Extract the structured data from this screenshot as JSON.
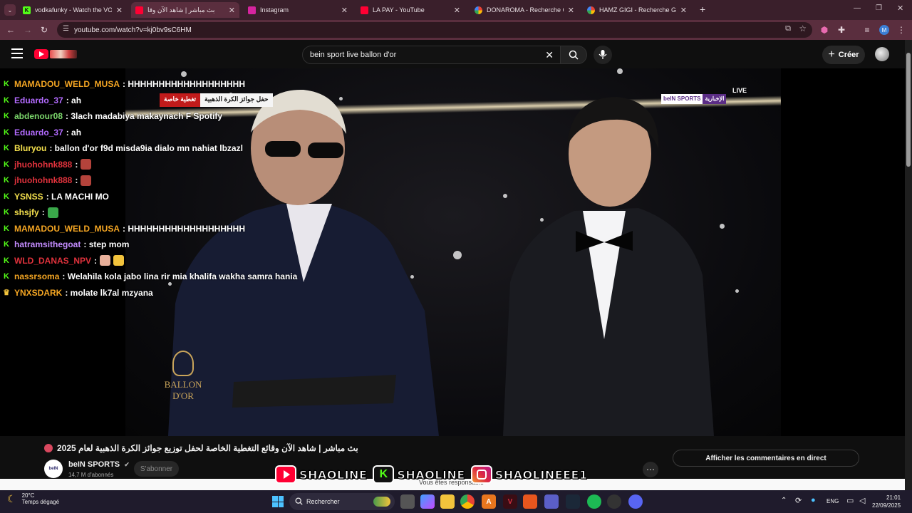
{
  "browser": {
    "tabs": [
      {
        "title": "vodkafunky - Watch the VOD o",
        "favicon": "kick-icon",
        "color": "#53fc18",
        "active": false
      },
      {
        "title": "بث مباشر | شاهد الآن وقا",
        "favicon": "youtube-icon",
        "color": "#ff0033",
        "active": true
      },
      {
        "title": "Instagram",
        "favicon": "instagram-icon",
        "color": "#d6249f",
        "active": false
      },
      {
        "title": "LA PAY - YouTube",
        "favicon": "youtube-icon",
        "color": "#ff0033",
        "active": false
      },
      {
        "title": "DONAROMA - Recherche Goog",
        "favicon": "google-icon",
        "color": "#ffffff",
        "active": false
      },
      {
        "title": "HAMZ GIGI - Recherche Google",
        "favicon": "google-icon",
        "color": "#ffffff",
        "active": false
      }
    ],
    "new_tab": "+",
    "url": "youtube.com/watch?v=kj0bv9sC6HM",
    "profile_initial": "M"
  },
  "youtube": {
    "search_value": "bein sport live ballon d'or",
    "create_label": "Créer",
    "video": {
      "title": "بث مباشر | شاهد الآن وقائع التغطية الخاصة لحفل توزيع جوائز الكرة الذهبية لعام 2025",
      "channel": "beIN SPORTS",
      "subscribers": "14,7 M d'abonnés",
      "subscribe_label": "S'abonner",
      "live_chat_label": "Afficher les commentaires en direct",
      "responsable_text": "Vous êtes responsable"
    },
    "overlay": {
      "banner_red": "تغطية خاصة",
      "banner_white": "حفل جوائز الكرة الذهبية",
      "live_label": "LIVE",
      "bein_label": "beIN SPORTS",
      "bein_arabic": "الإخبارية",
      "ballon_line1": "BALLON",
      "ballon_line2": "D'OR"
    }
  },
  "chat": [
    {
      "user": "MAMADOU_WELD_MUSA",
      "color": "#f5a623",
      "msg": ": HHHHHHHHHHHHHHHHHHH",
      "badge": "K",
      "emotes": []
    },
    {
      "user": "Eduardo_37",
      "color": "#b36bff",
      "msg": ": ah",
      "badge": "K",
      "emotes": []
    },
    {
      "user": "abdenour08",
      "color": "#7bd66b",
      "msg": ": 3lach madabiya makaynach F Spotify",
      "badge": "K",
      "emotes": []
    },
    {
      "user": "Eduardo_37",
      "color": "#b36bff",
      "msg": ": ah",
      "badge": "K",
      "emotes": []
    },
    {
      "user": "Bluryou",
      "color": "#f4e04d",
      "msg": ": ballon d'or f9d misda9ia dialo mn nahiat lbzazl",
      "badge": "K",
      "emotes": []
    },
    {
      "user": "jhuohohnk888",
      "color": "#e0323c",
      "msg": ":",
      "badge": "K",
      "emotes": [
        "#b4433b"
      ]
    },
    {
      "user": "jhuohohnk888",
      "color": "#e0323c",
      "msg": ":",
      "badge": "K",
      "emotes": [
        "#b4433b"
      ]
    },
    {
      "user": "YSNSS",
      "color": "#f4e04d",
      "msg": ": LA MACHI MO",
      "badge": "K",
      "emotes": []
    },
    {
      "user": "shsjfy",
      "color": "#f4e04d",
      "msg": ":",
      "badge": "K",
      "emotes": [
        "#3aa84a"
      ]
    },
    {
      "user": "MAMADOU_WELD_MUSA",
      "color": "#f5a623",
      "msg": ": HHHHHHHHHHHHHHHHHHH",
      "badge": "K",
      "emotes": []
    },
    {
      "user": "hatramsithegoat",
      "color": "#c48cff",
      "msg": ": step mom",
      "badge": "K",
      "emotes": []
    },
    {
      "user": "WLD_DANAS_NPV",
      "color": "#e0323c",
      "msg": ":",
      "badge": "K",
      "emotes": [
        "#e8b09a",
        "#f2c33c"
      ]
    },
    {
      "user": "nassrsoma",
      "color": "#f5a623",
      "msg": ": Welahila kola jabo lina rir mia khalifa wakha samra hania",
      "badge": "K",
      "emotes": []
    },
    {
      "user": "YNXSDARK",
      "color": "#f5a623",
      "msg": ": molate lk7al mzyana",
      "badge": "crown",
      "emotes": []
    }
  ],
  "social_banner": {
    "youtube": "SHAOLINE",
    "kick": "SHAOLINE",
    "instagram": "SHAOLINEEE1"
  },
  "taskbar": {
    "temperature": "20°C",
    "weather": "Temps dégagé",
    "search_label": "Rechercher",
    "language": "ENG",
    "time": "21:01",
    "date": "22/09/2025"
  }
}
